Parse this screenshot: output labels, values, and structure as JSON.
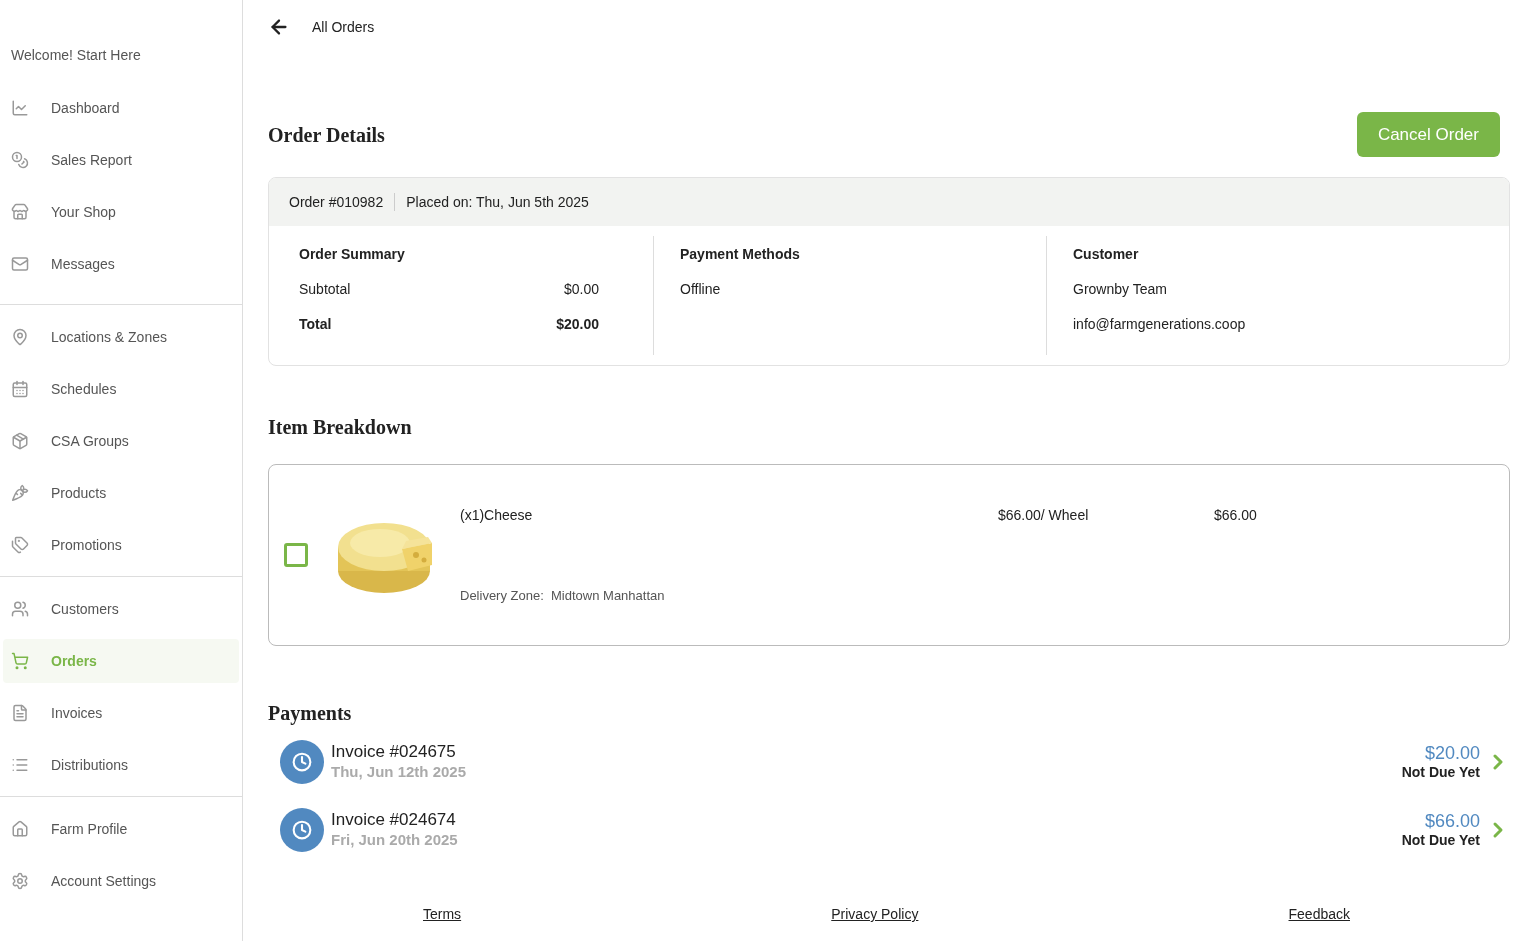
{
  "sidebar": {
    "welcome": "Welcome! Start Here",
    "groups": [
      [
        {
          "label": "Dashboard",
          "selected": false
        },
        {
          "label": "Sales Report",
          "selected": false
        },
        {
          "label": "Your Shop",
          "selected": false
        },
        {
          "label": "Messages",
          "selected": false
        }
      ],
      [
        {
          "label": "Locations & Zones",
          "selected": false
        },
        {
          "label": "Schedules",
          "selected": false
        },
        {
          "label": "CSA Groups",
          "selected": false
        },
        {
          "label": "Products",
          "selected": false
        },
        {
          "label": "Promotions",
          "selected": false
        }
      ],
      [
        {
          "label": "Customers",
          "selected": false
        },
        {
          "label": "Orders",
          "selected": true
        },
        {
          "label": "Invoices",
          "selected": false
        },
        {
          "label": "Distributions",
          "selected": false
        }
      ],
      [
        {
          "label": "Farm Profile",
          "selected": false
        },
        {
          "label": "Account Settings",
          "selected": false
        }
      ]
    ]
  },
  "back_link": "All Orders",
  "title": "Order Details",
  "cancel_button": "Cancel Order",
  "order": {
    "number": "Order #010982",
    "placed": "Placed on: Thu, Jun 5th 2025",
    "summary": {
      "heading": "Order Summary",
      "rows": [
        {
          "label": "Subtotal",
          "value": "$0.00",
          "bold": false
        },
        {
          "label": "Total",
          "value": "$20.00",
          "bold": true
        }
      ]
    },
    "payment": {
      "heading": "Payment Methods",
      "lines": [
        "Offline"
      ]
    },
    "customer": {
      "heading": "Customer",
      "lines": [
        "Grownby Team",
        "info@farmgenerations.coop"
      ]
    }
  },
  "items_heading": "Item Breakdown",
  "items": [
    {
      "checked": false,
      "name": "(x1)Cheese",
      "zone": "Delivery Zone:  Midtown Manhattan",
      "unit_price": "$66.00/ Wheel",
      "total": "$66.00"
    }
  ],
  "payments_heading": "Payments",
  "payments": [
    {
      "invoice": "Invoice #024675",
      "date": "Thu, Jun 12th 2025",
      "amount": "$20.00",
      "status": "Not Due Yet"
    },
    {
      "invoice": "Invoice #024674",
      "date": "Fri, Jun 20th 2025",
      "amount": "$66.00",
      "status": "Not Due Yet"
    }
  ],
  "footer_links": [
    "Terms",
    "Privacy Policy",
    "Feedback"
  ]
}
